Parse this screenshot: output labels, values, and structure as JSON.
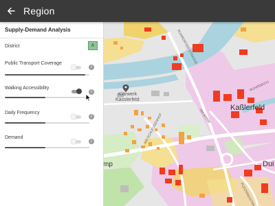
{
  "app_bar": {
    "title": "Region",
    "back_icon": "arrow-back-icon"
  },
  "panel": {
    "title": "Supply-Demand Analysis",
    "district": {
      "label": "District",
      "button_label": "A"
    },
    "rows": [
      {
        "label": "Public Transport Coverage",
        "toggle": "off",
        "slider": 0.95
      },
      {
        "label": "Walking Accessibility",
        "toggle": "on",
        "slider": 0.48
      },
      {
        "label": "Daily Frequency",
        "toggle": "off",
        "slider": 0.48
      },
      {
        "label": "Demand",
        "toggle": "off",
        "slider": 0.48
      }
    ],
    "info_glyph": "i"
  },
  "map": {
    "labels": {
      "klaerwerk_1": "Klärwerk",
      "klaerwerk_2": "Kasslerfeld",
      "kasslerfeld": "Kaßlerfeld",
      "street_ruhrort": "RUHRORTER STRASSE",
      "street_schleuse": "AM SCHLEUSENHOF",
      "street_brink": "AM BRINK",
      "street_ruhrdeich": "RUHRDEICH",
      "street_plessing": "PLESSINGSTRASSE",
      "edge_duis": "Dui",
      "edge_amp": "mp"
    },
    "colors": {
      "water": "#aad3df",
      "land": "#e8e8e8",
      "residential": "#efc9e8",
      "industrial": "#f1d36e",
      "red_buildings": "#f03b20",
      "orange_buildings": "#f5a142",
      "green": "#bfe3a9"
    }
  }
}
